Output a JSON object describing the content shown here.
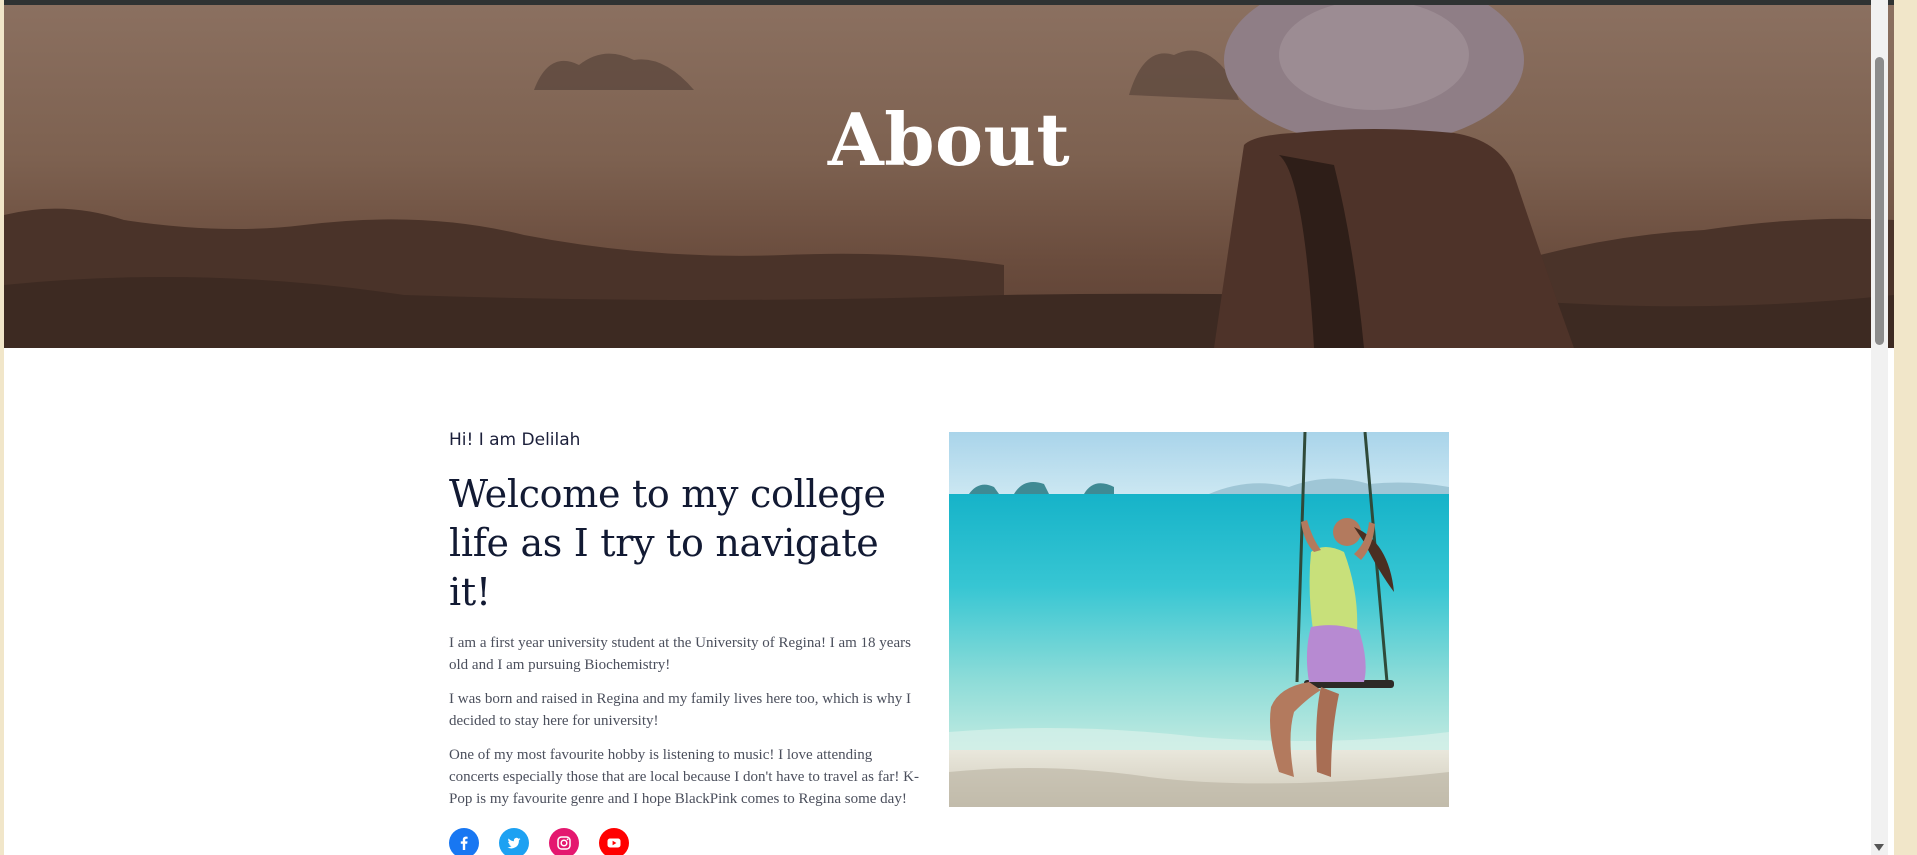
{
  "hero": {
    "title": "About"
  },
  "intro": {
    "eyebrow": "Hi! I am Delilah",
    "headline": "Welcome to my college life as I try to navigate it!",
    "paragraphs": [
      "I am a first year university student at the University of Regina! I am 18 years old and I am pursuing Biochemistry!",
      "I was born and raised in Regina and my family lives here too, which is why I decided to stay here for university!",
      "One of my most favourite hobby is listening to music! I love attending concerts especially those that are local because I don't have to travel as far! K-Pop is my favourite genre and I hope BlackPink comes to Regina some day!"
    ]
  },
  "socials": [
    {
      "icon": "facebook-icon",
      "color": "#1877f2"
    },
    {
      "icon": "twitter-icon",
      "color": "#1da1f2"
    },
    {
      "icon": "instagram-icon",
      "color": "#e4405f"
    },
    {
      "icon": "youtube-icon",
      "color": "#ff0000"
    }
  ],
  "colors": {
    "page_background": "#ffffff",
    "heading": "#121a33",
    "body_text": "#4b4f5c",
    "outer_frame": "#f1e6c9"
  }
}
